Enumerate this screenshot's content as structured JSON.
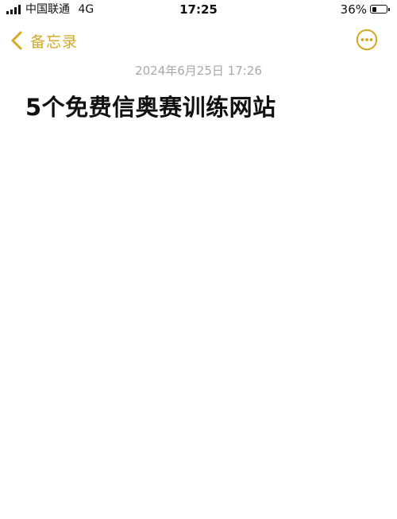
{
  "status_bar": {
    "carrier": "中国联通",
    "network": "4G",
    "time": "17:25",
    "battery_percent": "36%",
    "battery_level": 0.36
  },
  "nav": {
    "back_label": "备忘录",
    "back_icon": "chevron-left-icon",
    "more_icon": "ellipsis-circle-icon",
    "accent_color": "#d6a721"
  },
  "note": {
    "date": "2024年6月25日 17:26",
    "title": "5个免费信奥赛训练网站"
  }
}
